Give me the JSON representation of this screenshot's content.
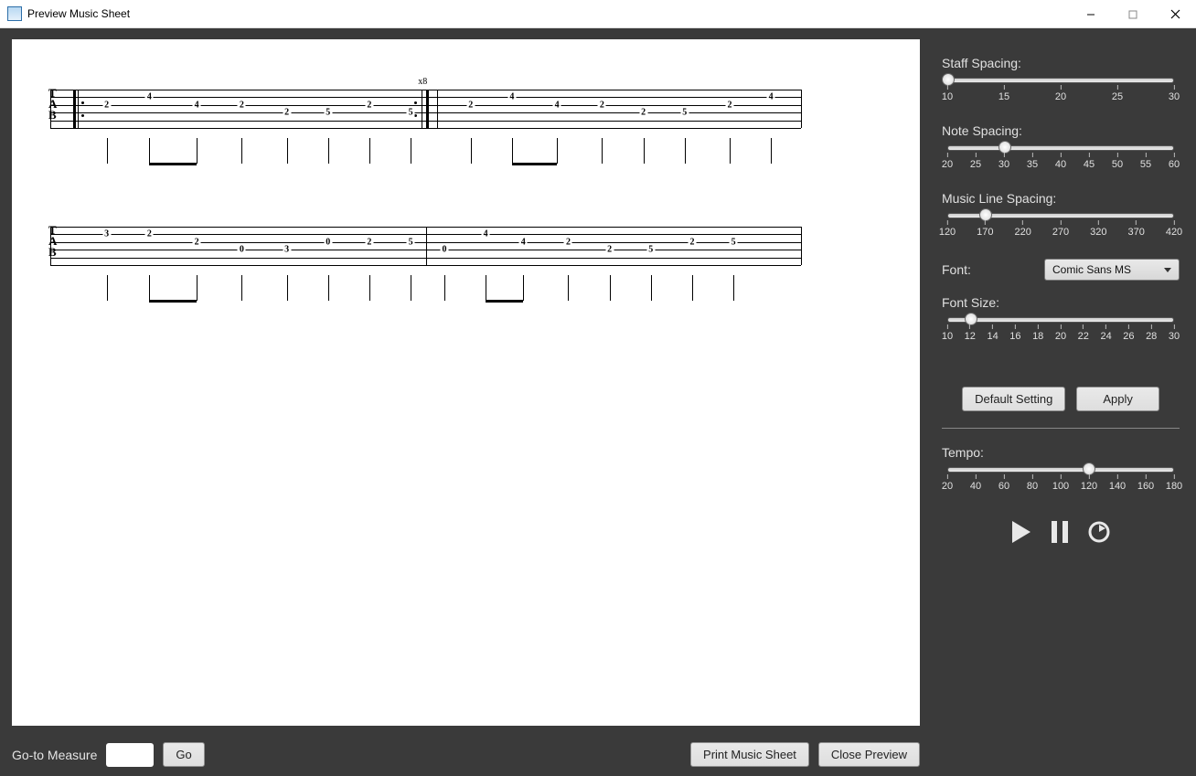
{
  "window": {
    "title": "Preview Music Sheet"
  },
  "sliders": {
    "staff": {
      "label": "Staff Spacing:",
      "min": 10,
      "max": 30,
      "value": 10,
      "ticks": [
        10,
        15,
        20,
        25,
        30
      ]
    },
    "note": {
      "label": "Note Spacing:",
      "min": 20,
      "max": 60,
      "value": 30,
      "ticks": [
        20,
        25,
        30,
        35,
        40,
        45,
        50,
        55,
        60
      ]
    },
    "musicLine": {
      "label": "Music Line Spacing:",
      "min": 120,
      "max": 420,
      "value": 170,
      "ticks": [
        120,
        170,
        220,
        270,
        320,
        370,
        420
      ]
    },
    "fontSize": {
      "label": "Font Size:",
      "min": 10,
      "max": 30,
      "value": 12,
      "ticks": [
        10,
        12,
        14,
        16,
        18,
        20,
        22,
        24,
        26,
        28,
        30
      ]
    },
    "tempo": {
      "label": "Tempo:",
      "min": 20,
      "max": 180,
      "value": 120,
      "ticks": [
        20,
        40,
        60,
        80,
        100,
        120,
        140,
        160,
        180
      ]
    }
  },
  "font": {
    "label": "Font:",
    "value": "Comic Sans MS"
  },
  "buttons": {
    "default": "Default Setting",
    "apply": "Apply",
    "go": "Go",
    "print": "Print Music Sheet",
    "close": "Close Preview"
  },
  "gotoLabel": "Go-to Measure",
  "annotations": {
    "repeat": "x8"
  },
  "tab": {
    "strings": 6,
    "staves": [
      {
        "notes": [
          {
            "x": 7.5,
            "s": 3,
            "v": "2"
          },
          {
            "x": 13.2,
            "s": 2,
            "v": "4"
          },
          {
            "x": 19.5,
            "s": 3,
            "v": "4"
          },
          {
            "x": 25.5,
            "s": 3,
            "v": "2"
          },
          {
            "x": 31.5,
            "s": 4,
            "v": "2"
          },
          {
            "x": 37.0,
            "s": 4,
            "v": "5"
          },
          {
            "x": 42.5,
            "s": 3,
            "v": "2"
          },
          {
            "x": 48.0,
            "s": 4,
            "v": "5"
          },
          {
            "x": 56.0,
            "s": 3,
            "v": "2"
          },
          {
            "x": 61.5,
            "s": 2,
            "v": "4"
          },
          {
            "x": 67.5,
            "s": 3,
            "v": "4"
          },
          {
            "x": 73.5,
            "s": 3,
            "v": "2"
          },
          {
            "x": 79.0,
            "s": 4,
            "v": "2"
          },
          {
            "x": 84.5,
            "s": 4,
            "v": "5"
          },
          {
            "x": 90.5,
            "s": 3,
            "v": "2"
          },
          {
            "x": 96.0,
            "s": 2,
            "v": "4"
          }
        ],
        "bars": [
          0,
          51.5,
          100
        ],
        "repeatStart": 3.0,
        "repeatEnd": 50.0,
        "beams": [
          [
            13.2,
            19.5
          ],
          [
            61.5,
            67.5
          ]
        ]
      },
      {
        "notes": [
          {
            "x": 7.5,
            "s": 2,
            "v": "3"
          },
          {
            "x": 13.2,
            "s": 2,
            "v": "2"
          },
          {
            "x": 19.5,
            "s": 3,
            "v": "2"
          },
          {
            "x": 25.5,
            "s": 4,
            "v": "0"
          },
          {
            "x": 31.5,
            "s": 4,
            "v": "3"
          },
          {
            "x": 37.0,
            "s": 3,
            "v": "0"
          },
          {
            "x": 42.5,
            "s": 3,
            "v": "2"
          },
          {
            "x": 48.0,
            "s": 3,
            "v": "5"
          },
          {
            "x": 52.5,
            "s": 4,
            "v": "0"
          },
          {
            "x": 58.0,
            "s": 2,
            "v": "4"
          },
          {
            "x": 63.0,
            "s": 3,
            "v": "4"
          },
          {
            "x": 69.0,
            "s": 3,
            "v": "2"
          },
          {
            "x": 74.5,
            "s": 4,
            "v": "2"
          },
          {
            "x": 80.0,
            "s": 4,
            "v": "5"
          },
          {
            "x": 85.5,
            "s": 3,
            "v": "2"
          },
          {
            "x": 91.0,
            "s": 3,
            "v": "5"
          }
        ],
        "bars": [
          0,
          50,
          100
        ],
        "beams": [
          [
            13.2,
            19.5
          ],
          [
            58.0,
            63.0
          ]
        ]
      }
    ]
  }
}
